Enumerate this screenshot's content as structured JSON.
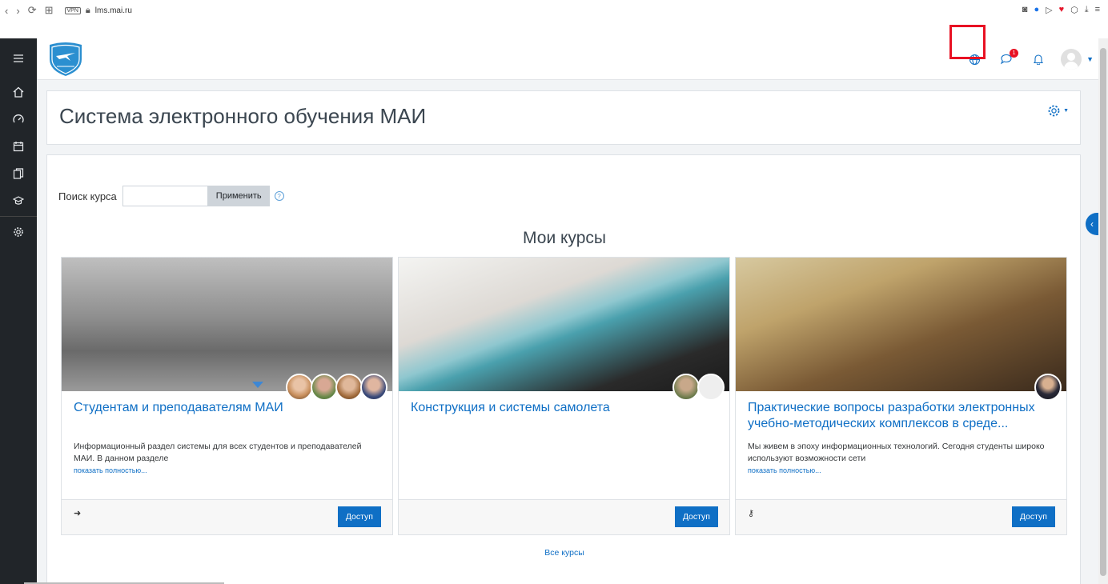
{
  "browser": {
    "back": "‹",
    "forward": "›",
    "reload": "⟳",
    "grid": "⊞",
    "vpn": "VPN",
    "url": "lms.mai.ru"
  },
  "navbar": {
    "message_badge": "1"
  },
  "page": {
    "title": "Система электронного обучения МАИ"
  },
  "search": {
    "label": "Поиск курса",
    "value": "",
    "button": "Применить",
    "help": "?"
  },
  "section_title": "Мои курсы",
  "courses": [
    {
      "title": "Студентам и преподавателям МАИ",
      "description": "Информационный раздел системы для всех студентов и преподавателей МАИ. В данном разделе",
      "more": "показать полностью...",
      "button": "Доступ"
    },
    {
      "title": "Конструкция и системы самолета",
      "description": "",
      "more": "",
      "button": "Доступ"
    },
    {
      "title": "Практические вопросы разработки электронных учебно-методических комплексов в среде...",
      "description": "Мы живем в эпоху информационных технологий. Сегодня студенты широко используют возможности сети",
      "more": "показать полностью...",
      "button": "Доступ"
    }
  ],
  "all_courses": "Все курсы",
  "colors": {
    "accent": "#0f6fc5",
    "drawer": "#212529",
    "highlight": "#e81123"
  },
  "icons": [
    "menu-icon",
    "home-icon",
    "dashboard-icon",
    "calendar-icon",
    "files-icon",
    "courses-icon",
    "settings-icon",
    "globe-icon",
    "chat-icon",
    "bell-icon",
    "gear-icon"
  ]
}
